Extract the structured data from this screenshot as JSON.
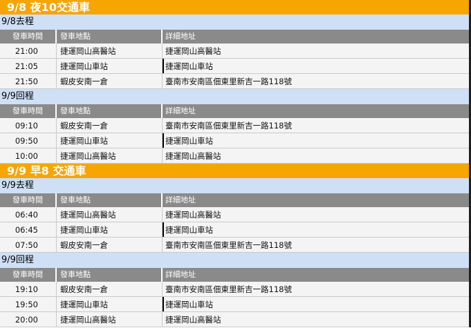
{
  "headers": {
    "time": "發車時間",
    "place": "發車地點",
    "address": "詳細地址"
  },
  "sections": [
    {
      "title": "9/8 夜10交通車",
      "trips": [
        {
          "label": "9/8去程",
          "rows": [
            {
              "time": "21:00",
              "place": "捷運岡山高醫站",
              "address": "捷運岡山高醫站"
            },
            {
              "time": "21:05",
              "place": "捷運岡山車站",
              "address": "捷運岡山車站"
            },
            {
              "time": "21:50",
              "place": "蝦皮安南一倉",
              "address": "臺南市安南區佃東里新吉一路118號"
            }
          ]
        },
        {
          "label": "9/9回程",
          "rows": [
            {
              "time": "09:10",
              "place": "蝦皮安南一倉",
              "address": "臺南市安南區佃東里新吉一路118號"
            },
            {
              "time": "09:50",
              "place": "捷運岡山車站",
              "address": "捷運岡山車站"
            },
            {
              "time": "10:00",
              "place": "捷運岡山高醫站",
              "address": "捷運岡山高醫站"
            }
          ]
        }
      ]
    },
    {
      "title": "9/9 早8 交通車",
      "trips": [
        {
          "label": "9/9去程",
          "rows": [
            {
              "time": "06:40",
              "place": "捷運岡山高醫站",
              "address": "捷運岡山高醫站"
            },
            {
              "time": "06:45",
              "place": "捷運岡山車站",
              "address": "捷運岡山車站"
            },
            {
              "time": "07:50",
              "place": "蝦皮安南一倉",
              "address": "臺南市安南區佃東里新吉一路118號"
            }
          ]
        },
        {
          "label": "9/9回程",
          "rows": [
            {
              "time": "19:10",
              "place": "蝦皮安南一倉",
              "address": "臺南市安南區佃東里新吉一路118號"
            },
            {
              "time": "19:50",
              "place": "捷運岡山車站",
              "address": "捷運岡山車站"
            },
            {
              "time": "20:00",
              "place": "捷運岡山高醫站",
              "address": "捷運岡山高醫站"
            }
          ]
        }
      ]
    }
  ],
  "colors": {
    "section_bar": "#f7a500",
    "trip_bar": "#cfe0f6",
    "column_header": "#8a8a8a",
    "row_background": "#f4f4f4"
  }
}
